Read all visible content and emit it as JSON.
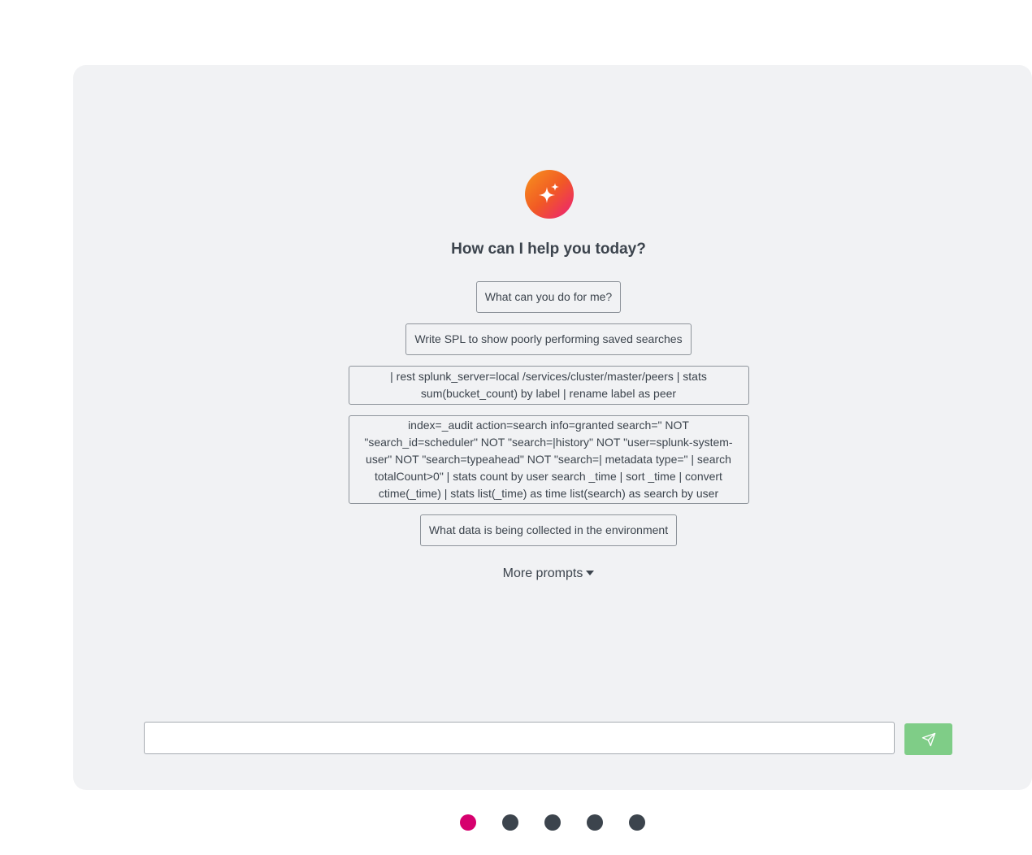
{
  "assistant": {
    "logo_icon": "sparkle-icon",
    "heading": "How can I help you today?"
  },
  "prompts": [
    "What can you do for me?",
    "Write SPL to show poorly performing saved searches",
    "| rest splunk_server=local /services/cluster/master/peers | stats sum(bucket_count) by label | rename label as peer",
    "index=_audit action=search info=granted search=\" NOT \"search_id=scheduler\" NOT \"search=|history\" NOT \"user=splunk-system-user\" NOT \"search=typeahead\" NOT \"search=| metadata type=\" | search totalCount>0\" | stats count by user search _time | sort _time | convert ctime(_time) | stats list(_time) as time list(search) as search by user",
    "What data is being collected in the environment"
  ],
  "more_prompts_label": "More prompts",
  "chat": {
    "input_value": "",
    "input_placeholder": "",
    "send_icon": "paper-plane-icon"
  },
  "pagination": {
    "count": 5,
    "active_index": 0
  },
  "colors": {
    "panel_bg": "#f1f2f4",
    "send_button": "#7fcd87",
    "active_dot": "#d6006e",
    "inactive_dot": "#3c444d"
  }
}
